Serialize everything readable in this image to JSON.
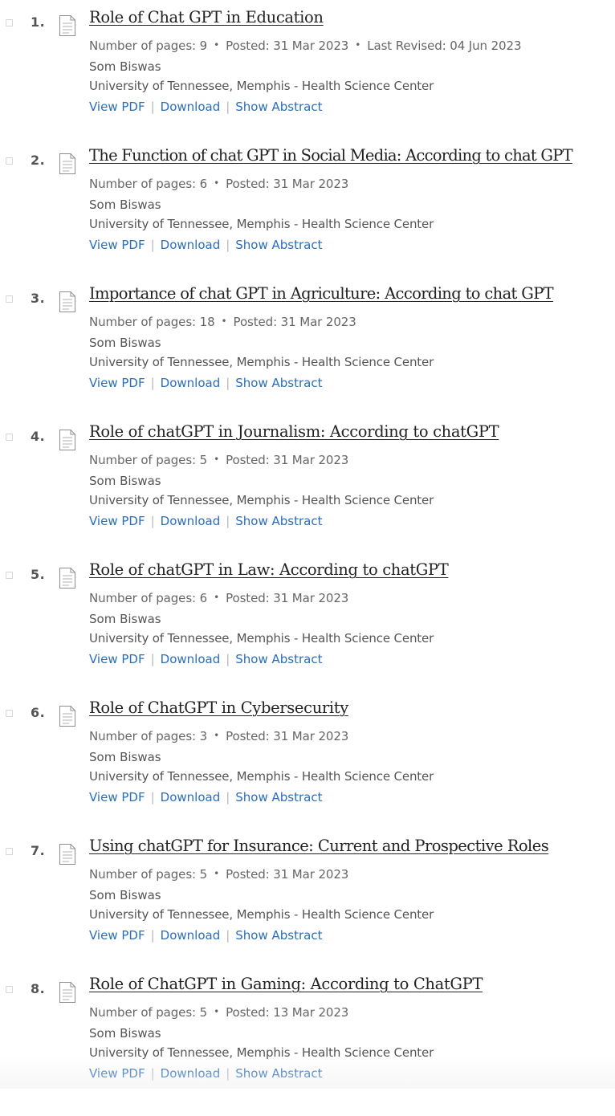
{
  "papers": [
    {
      "rank": "1.",
      "title": "Role of Chat GPT in Education",
      "pages": "Number of pages: 9",
      "posted": "Posted: 31 Mar 2023",
      "revised": "Last Revised: 04 Jun 2023",
      "author": "Som Biswas",
      "affiliation": "University of Tennessee, Memphis - Health Science Center",
      "view_pdf": "View PDF",
      "download": "Download",
      "show_abstract": "Show Abstract"
    },
    {
      "rank": "2.",
      "title": "The Function of chat GPT in Social Media: According to chat GPT",
      "pages": "Number of pages: 6",
      "posted": "Posted: 31 Mar 2023",
      "author": "Som Biswas",
      "affiliation": "University of Tennessee, Memphis - Health Science Center",
      "view_pdf": "View PDF",
      "download": "Download",
      "show_abstract": "Show Abstract"
    },
    {
      "rank": "3.",
      "title": "Importance of chat GPT in Agriculture: According to chat GPT",
      "pages": "Number of pages: 18",
      "posted": "Posted: 31 Mar 2023",
      "author": "Som Biswas",
      "affiliation": "University of Tennessee, Memphis - Health Science Center",
      "view_pdf": "View PDF",
      "download": "Download",
      "show_abstract": "Show Abstract"
    },
    {
      "rank": "4.",
      "title": "Role of chatGPT in Journalism: According to chatGPT",
      "pages": "Number of pages: 5",
      "posted": "Posted: 31 Mar 2023",
      "author": "Som Biswas",
      "affiliation": "University of Tennessee, Memphis - Health Science Center",
      "view_pdf": "View PDF",
      "download": "Download",
      "show_abstract": "Show Abstract"
    },
    {
      "rank": "5.",
      "title": "Role of chatGPT in Law: According to chatGPT",
      "pages": "Number of pages: 6",
      "posted": "Posted: 31 Mar 2023",
      "author": "Som Biswas",
      "affiliation": "University of Tennessee, Memphis - Health Science Center",
      "view_pdf": "View PDF",
      "download": "Download",
      "show_abstract": "Show Abstract"
    },
    {
      "rank": "6.",
      "title": "Role of ChatGPT in Cybersecurity",
      "pages": "Number of pages: 3",
      "posted": "Posted: 31 Mar 2023",
      "author": "Som Biswas",
      "affiliation": "University of Tennessee, Memphis - Health Science Center",
      "view_pdf": "View PDF",
      "download": "Download",
      "show_abstract": "Show Abstract"
    },
    {
      "rank": "7.",
      "title": "Using chatGPT for Insurance: Current and Prospective Roles",
      "pages": "Number of pages: 5",
      "posted": "Posted: 31 Mar 2023",
      "author": "Som Biswas",
      "affiliation": "University of Tennessee, Memphis - Health Science Center",
      "view_pdf": "View PDF",
      "download": "Download",
      "show_abstract": "Show Abstract"
    },
    {
      "rank": "8.",
      "title": "Role of ChatGPT in Gaming: According to ChatGPT",
      "pages": "Number of pages: 5",
      "posted": "Posted: 13 Mar 2023",
      "author": "Som Biswas",
      "affiliation": "University of Tennessee, Memphis - Health Science Center",
      "view_pdf": "View PDF",
      "download": "Download",
      "show_abstract": "Show Abstract"
    }
  ]
}
